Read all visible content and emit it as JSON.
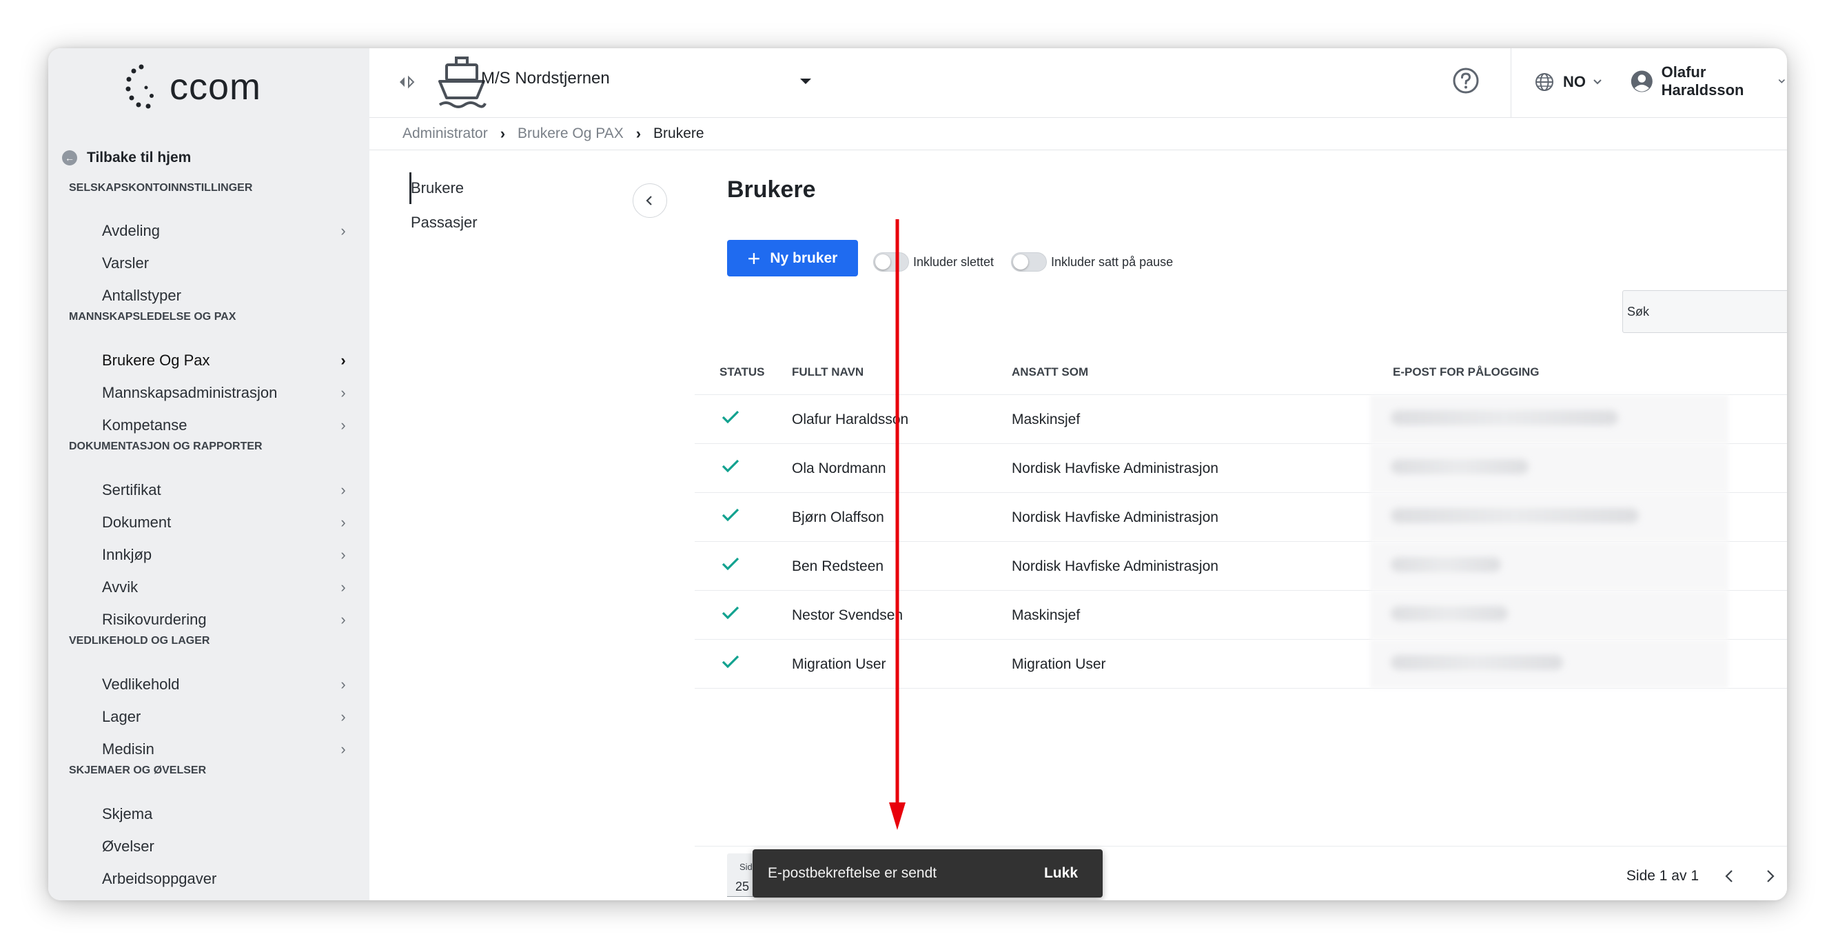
{
  "brand": {
    "name": "ccom"
  },
  "sidebar": {
    "back_label": "Tilbake til hjem",
    "sections": [
      {
        "title": "SELSKAPSKONTOINNSTILLINGER",
        "items": [
          {
            "label": "Avdeling",
            "chevron": true
          },
          {
            "label": "Varsler",
            "chevron": false
          },
          {
            "label": "Antallstyper",
            "chevron": false
          }
        ]
      },
      {
        "title": "MANNSKAPSLEDELSE OG PAX",
        "items": [
          {
            "label": "Brukere Og Pax",
            "chevron": true,
            "active": true
          },
          {
            "label": "Mannskapsadministrasjon",
            "chevron": true
          },
          {
            "label": "Kompetanse",
            "chevron": true
          }
        ]
      },
      {
        "title": "DOKUMENTASJON OG RAPPORTER",
        "items": [
          {
            "label": "Sertifikat",
            "chevron": true
          },
          {
            "label": "Dokument",
            "chevron": true
          },
          {
            "label": "Innkjøp",
            "chevron": true
          },
          {
            "label": "Avvik",
            "chevron": true
          },
          {
            "label": "Risikovurdering",
            "chevron": true
          }
        ]
      },
      {
        "title": "VEDLIKEHOLD OG LAGER",
        "items": [
          {
            "label": "Vedlikehold",
            "chevron": true
          },
          {
            "label": "Lager",
            "chevron": true
          },
          {
            "label": "Medisin",
            "chevron": true
          }
        ]
      },
      {
        "title": "SKJEMAER OG ØVELSER",
        "items": [
          {
            "label": "Skjema",
            "chevron": false
          },
          {
            "label": "Øvelser",
            "chevron": false
          },
          {
            "label": "Arbeidsoppgaver",
            "chevron": false
          }
        ]
      }
    ]
  },
  "topbar": {
    "vessel_name": "M/S Nordstjernen",
    "language": "NO",
    "user_name": "Olafur Haraldsson"
  },
  "breadcrumb": [
    "Administrator",
    "Brukere Og PAX",
    "Brukere"
  ],
  "submenu": {
    "items": [
      "Brukere",
      "Passasjer"
    ],
    "active": "Brukere"
  },
  "main": {
    "title": "Brukere",
    "new_button": "Ny bruker",
    "toggle_deleted": "Inkluder slettet",
    "toggle_paused": "Inkluder satt på pause",
    "search_placeholder": "Søk"
  },
  "table": {
    "headers": {
      "status": "STATUS",
      "name": "FULLT NAVN",
      "role": "ANSATT SOM",
      "email": "E-POST FOR PÅLOGGING"
    },
    "rows": [
      {
        "status": "active",
        "name": "Olafur Haraldsson",
        "role": "Maskinsjef"
      },
      {
        "status": "active",
        "name": "Ola Nordmann",
        "role": "Nordisk Havfiske Administrasjon"
      },
      {
        "status": "active",
        "name": "Bjørn Olaffson",
        "role": "Nordisk Havfiske Administrasjon"
      },
      {
        "status": "active",
        "name": "Ben Redsteen",
        "role": "Nordisk Havfiske Administrasjon"
      },
      {
        "status": "active",
        "name": "Nestor Svendsen",
        "role": "Maskinsjef"
      },
      {
        "status": "active",
        "name": "Migration User",
        "role": "Migration User"
      }
    ]
  },
  "footer": {
    "page_size_label": "Sidestørrelse",
    "page_size": "25",
    "page_info": "Side 1 av 1"
  },
  "snackbar": {
    "message": "E-postbekreftelse er sendt",
    "action": "Lukk"
  },
  "colors": {
    "primary": "#1f6bf0",
    "success": "#12a28f",
    "annotation": "#e8000b",
    "sidebar_bg": "#eeeff1",
    "snackbar_bg": "#323232"
  },
  "icons": {
    "back": "arrow-left-circle-icon",
    "ship": "ship-icon",
    "help": "help-circle-icon",
    "language": "globe-icon",
    "user": "user-avatar-icon",
    "status": "check-icon"
  }
}
